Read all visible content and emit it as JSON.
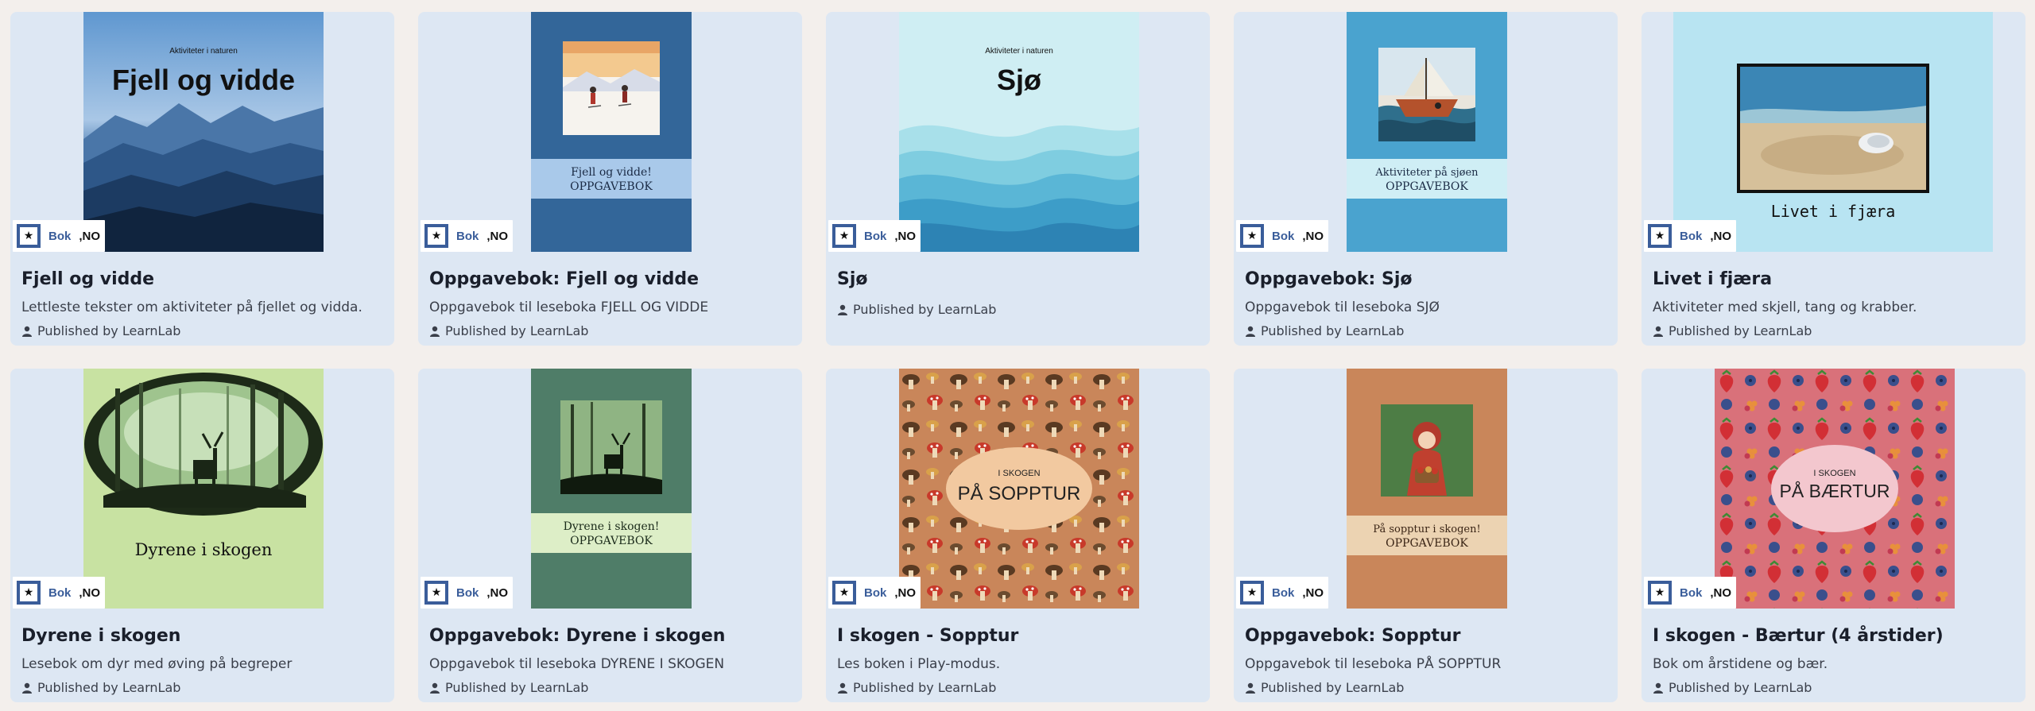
{
  "published_label": "Published by LearnLab",
  "badge": {
    "type": "Bok",
    "lang": ",NO",
    "icon": "★"
  },
  "cards": [
    {
      "title": "Fjell og vidde",
      "description": "Lettleste tekster om aktiviteter på fjellet og vidda.",
      "cover": {
        "subtitle": "Aktiviteter i naturen",
        "title": "Fjell og vidde"
      }
    },
    {
      "title": "Oppgavebok: Fjell og vidde",
      "description": "Oppgavebok til leseboka FJELL OG VIDDE",
      "cover": {
        "line1": "Fjell og vidde!",
        "line2": "OPPGAVEBOK"
      }
    },
    {
      "title": "Sjø",
      "description": "",
      "cover": {
        "subtitle": "Aktiviteter i naturen",
        "title": "Sjø"
      }
    },
    {
      "title": "Oppgavebok: Sjø",
      "description": "Oppgavebok til leseboka SJØ",
      "cover": {
        "line1": "Aktiviteter på sjøen",
        "line2": "OPPGAVEBOK"
      }
    },
    {
      "title": "Livet i fjæra",
      "description": "Aktiviteter med skjell, tang og krabber.",
      "cover": {
        "caption": "Livet i fjæra"
      }
    },
    {
      "title": "Dyrene i skogen",
      "description": "Lesebok om dyr med øving på begreper",
      "cover": {
        "caption": "Dyrene i skogen"
      }
    },
    {
      "title": "Oppgavebok: Dyrene i skogen",
      "description": "Oppgavebok til leseboka DYRENE I SKOGEN",
      "cover": {
        "line1": "Dyrene i skogen!",
        "line2": "OPPGAVEBOK"
      }
    },
    {
      "title": "I skogen - Sopptur",
      "description": "Les boken i Play-modus.",
      "cover": {
        "small": "I SKOGEN",
        "big": "PÅ SOPPTUR"
      }
    },
    {
      "title": "Oppgavebok: Sopptur",
      "description": "Oppgavebok til leseboka PÅ SOPPTUR",
      "cover": {
        "line1": "På sopptur i skogen!",
        "line2": "OPPGAVEBOK"
      }
    },
    {
      "title": "I skogen - Bærtur (4 årstider)",
      "description": "Bok om årstidene og bær.",
      "cover": {
        "small": "I SKOGEN",
        "big": "PÅ BÆRTUR"
      }
    }
  ]
}
